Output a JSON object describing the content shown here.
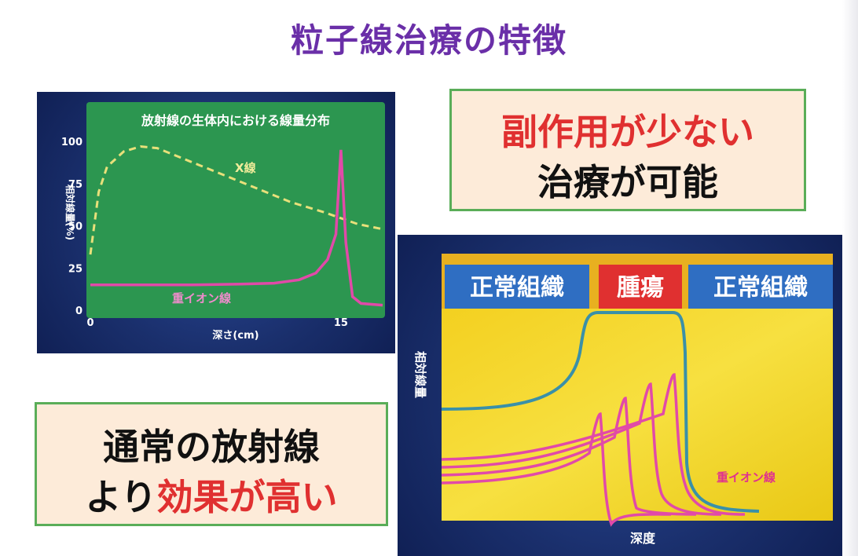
{
  "slide": {
    "title": "粒子線治療の特徴"
  },
  "box_top": {
    "line1": "副作用が少ない",
    "line2": "治療が可能"
  },
  "box_bottom": {
    "line1": "通常の放射線",
    "line2_prefix": "より",
    "line2_red": "効果が高い"
  },
  "colors": {
    "title": "#6a2fa8",
    "red": "#e03030",
    "box_border": "#5aad58",
    "box_fill": "#fdebd9"
  },
  "chart_data": [
    {
      "type": "line",
      "title": "放射線の生体内における線量分布",
      "xlabel": "深さ(cm)",
      "ylabel": "相対線量(%)",
      "xlim": [
        0,
        17.5
      ],
      "ylim": [
        0,
        100
      ],
      "x_ticks": [
        "0",
        "15"
      ],
      "y_ticks": [
        "0",
        "25",
        "50",
        "75",
        "100"
      ],
      "series": [
        {
          "name": "X線",
          "style": "dashed",
          "color": "#e8e07a",
          "points": [
            [
              0,
              33
            ],
            [
              0.5,
              70
            ],
            [
              1,
              85
            ],
            [
              2,
              94
            ],
            [
              3,
              97
            ],
            [
              4,
              96
            ],
            [
              6,
              88
            ],
            [
              8,
              80
            ],
            [
              10,
              72
            ],
            [
              12,
              64
            ],
            [
              14,
              58
            ],
            [
              16,
              51
            ],
            [
              17.5,
              48
            ]
          ]
        },
        {
          "name": "重イオン線",
          "style": "solid",
          "color": "#e14aa8",
          "points": [
            [
              0,
              15
            ],
            [
              6,
              15
            ],
            [
              9,
              15.5
            ],
            [
              11,
              16
            ],
            [
              12.5,
              18
            ],
            [
              13.5,
              22
            ],
            [
              14.2,
              30
            ],
            [
              14.7,
              45
            ],
            [
              15,
              95
            ],
            [
              15.3,
              40
            ],
            [
              15.7,
              8
            ],
            [
              16.2,
              4
            ],
            [
              17.5,
              3
            ]
          ]
        }
      ]
    },
    {
      "type": "line",
      "ylabel": "相対線量",
      "xlabel": "深度",
      "regions": [
        "正常組織",
        "腫瘍",
        "正常組織"
      ],
      "region_colors": [
        "#2f6ec2",
        "#e03030",
        "#2f6ec2"
      ],
      "series": [
        {
          "label": "重イオン線",
          "color": "#e14aa8"
        }
      ]
    }
  ]
}
